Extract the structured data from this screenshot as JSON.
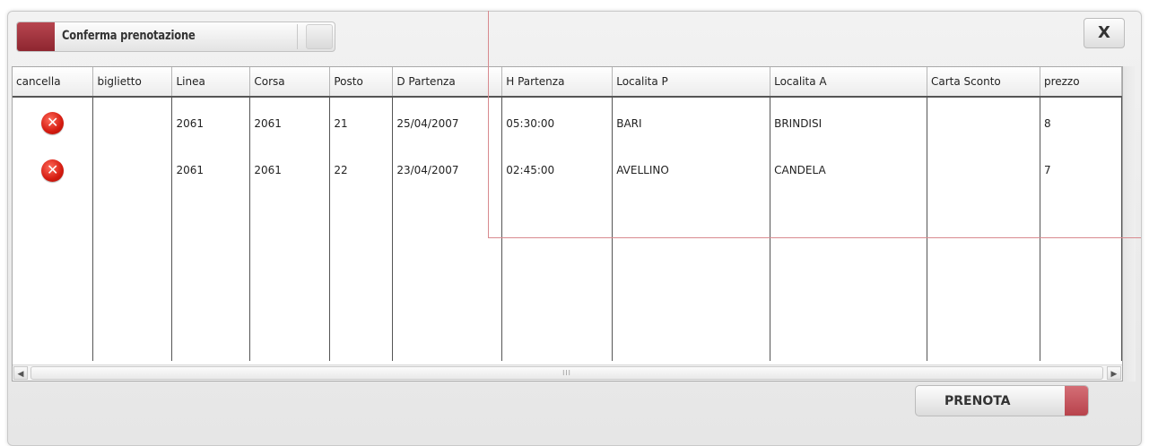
{
  "dialog": {
    "title": "Conferma prenotazione",
    "close_label": "X",
    "action_label": "PRENOTA"
  },
  "grid": {
    "columns": [
      "cancella",
      "biglietto",
      "Linea",
      "Corsa",
      "Posto",
      "D Partenza",
      "H Partenza",
      "Localita P",
      "Localita A",
      "Carta Sconto",
      "prezzo"
    ],
    "rows": [
      {
        "biglietto": "",
        "linea": "2061",
        "corsa": "2061",
        "posto": "21",
        "d_partenza": "25/04/2007",
        "h_partenza": "05:30:00",
        "localita_p": "BARI",
        "localita_a": "BRINDISI",
        "carta_sconto": "",
        "prezzo": "8"
      },
      {
        "biglietto": "",
        "linea": "2061",
        "corsa": "2061",
        "posto": "22",
        "d_partenza": "23/04/2007",
        "h_partenza": "02:45:00",
        "localita_p": "AVELLINO",
        "localita_a": "CANDELA",
        "carta_sconto": "",
        "prezzo": "7"
      }
    ],
    "delete_icon_glyph": "✕",
    "scroll_left_glyph": "◀",
    "scroll_right_glyph": "▶",
    "scroll_grip": "III"
  },
  "icons": {
    "delete": "delete-circle-icon",
    "accent_color": "#9e313a",
    "delete_color": "#d41b10"
  }
}
